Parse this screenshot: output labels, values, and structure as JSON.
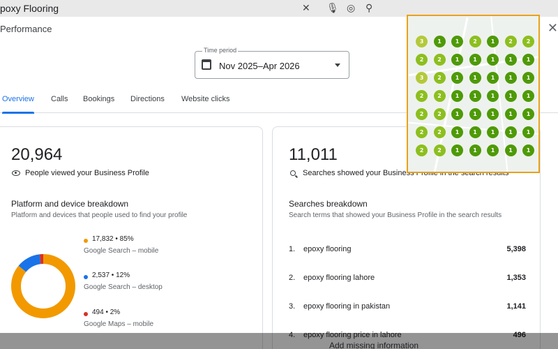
{
  "search": {
    "query": "poxy Flooring"
  },
  "header": {
    "title": "Performance"
  },
  "time_period": {
    "label": "Time period",
    "value": "Nov 2025–Apr 2026"
  },
  "tabs": [
    {
      "label": "Overview"
    },
    {
      "label": "Calls"
    },
    {
      "label": "Bookings"
    },
    {
      "label": "Directions"
    },
    {
      "label": "Website clicks"
    }
  ],
  "views_card": {
    "count": "20,964",
    "caption": "People viewed your Business Profile",
    "breakdown_title": "Platform and device breakdown",
    "breakdown_desc": "Platform and devices that people used to find your profile",
    "items": [
      {
        "stat": "17,832 • 85%",
        "label": "Google Search – mobile",
        "color": "#f29900",
        "fraction": 0.85
      },
      {
        "stat": "2,537 • 12%",
        "label": "Google Search – desktop",
        "color": "#1a73e8",
        "fraction": 0.12
      },
      {
        "stat": "494 • 2%",
        "label": "Google Maps – mobile",
        "color": "#d93025",
        "fraction": 0.02
      }
    ]
  },
  "searches_card": {
    "count": "11,011",
    "caption": "Searches showed your Business Profile in the search results",
    "breakdown_title": "Searches breakdown",
    "breakdown_desc": "Search terms that showed your Business Profile in the search results",
    "rows": [
      {
        "rank": "1.",
        "term": "epoxy flooring",
        "count": "5,398"
      },
      {
        "rank": "2.",
        "term": "epoxy flooring lahore",
        "count": "1,353"
      },
      {
        "rank": "3.",
        "term": "epoxy flooring in pakistan",
        "count": "1,141"
      },
      {
        "rank": "4.",
        "term": "epoxy flooring price in lahore",
        "count": "496"
      }
    ]
  },
  "footer": {
    "missing": "Add missing information"
  },
  "rank_grid": {
    "rows": [
      [
        3,
        1,
        1,
        2,
        1,
        2,
        2
      ],
      [
        2,
        2,
        1,
        1,
        1,
        1,
        1
      ],
      [
        3,
        2,
        1,
        1,
        1,
        1,
        1
      ],
      [
        2,
        2,
        1,
        1,
        1,
        1,
        1
      ],
      [
        2,
        2,
        1,
        1,
        1,
        1,
        1
      ],
      [
        2,
        2,
        1,
        1,
        1,
        1,
        1
      ],
      [
        2,
        2,
        1,
        1,
        1,
        1,
        1
      ]
    ],
    "colors": {
      "1": "#4e9a06",
      "2": "#8cbf1e",
      "3": "#b4c93a"
    }
  }
}
